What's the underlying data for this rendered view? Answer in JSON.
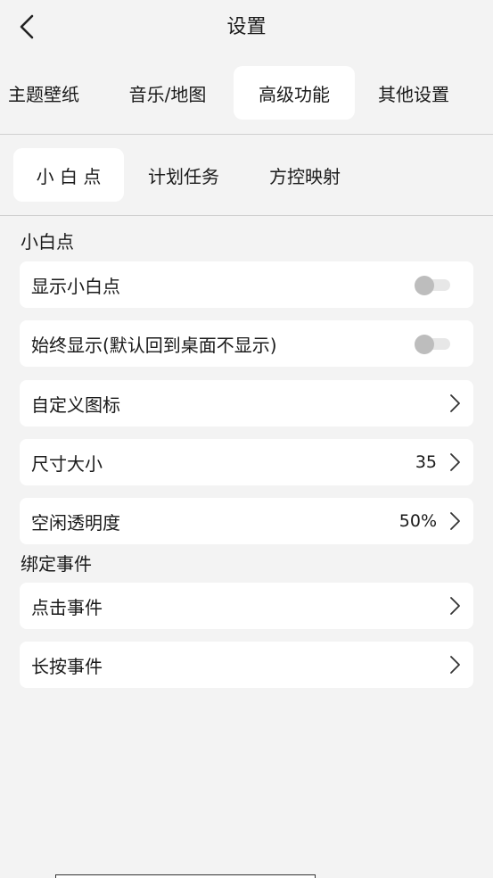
{
  "header": {
    "title": "设置",
    "back_icon": "chevron-left-icon"
  },
  "main_tabs": [
    {
      "label": "主题壁纸",
      "active": false
    },
    {
      "label": "音乐/地图",
      "active": false
    },
    {
      "label": "高级功能",
      "active": true
    },
    {
      "label": "其他设置",
      "active": false
    }
  ],
  "sub_tabs": [
    {
      "label": "小 白 点",
      "active": true
    },
    {
      "label": "计划任务",
      "active": false
    },
    {
      "label": "方控映射",
      "active": false
    }
  ],
  "section_small_dot": {
    "title": "小白点",
    "items": [
      {
        "label": "显示小白点",
        "type": "toggle",
        "on": false
      },
      {
        "label": "始终显示(默认回到桌面不显示)",
        "type": "toggle",
        "on": false
      },
      {
        "label": "自定义图标",
        "type": "link",
        "value": ""
      },
      {
        "label": "尺寸大小",
        "type": "link",
        "value": "35"
      },
      {
        "label": "空闲透明度",
        "type": "link",
        "value": "50%"
      }
    ]
  },
  "section_events": {
    "title": "绑定事件",
    "items": [
      {
        "label": "点击事件",
        "type": "link"
      },
      {
        "label": "长按事件",
        "type": "link"
      }
    ]
  },
  "colors": {
    "background": "#f3f3f3",
    "card": "#ffffff",
    "toggle_knob_off": "#bdbdbd"
  }
}
